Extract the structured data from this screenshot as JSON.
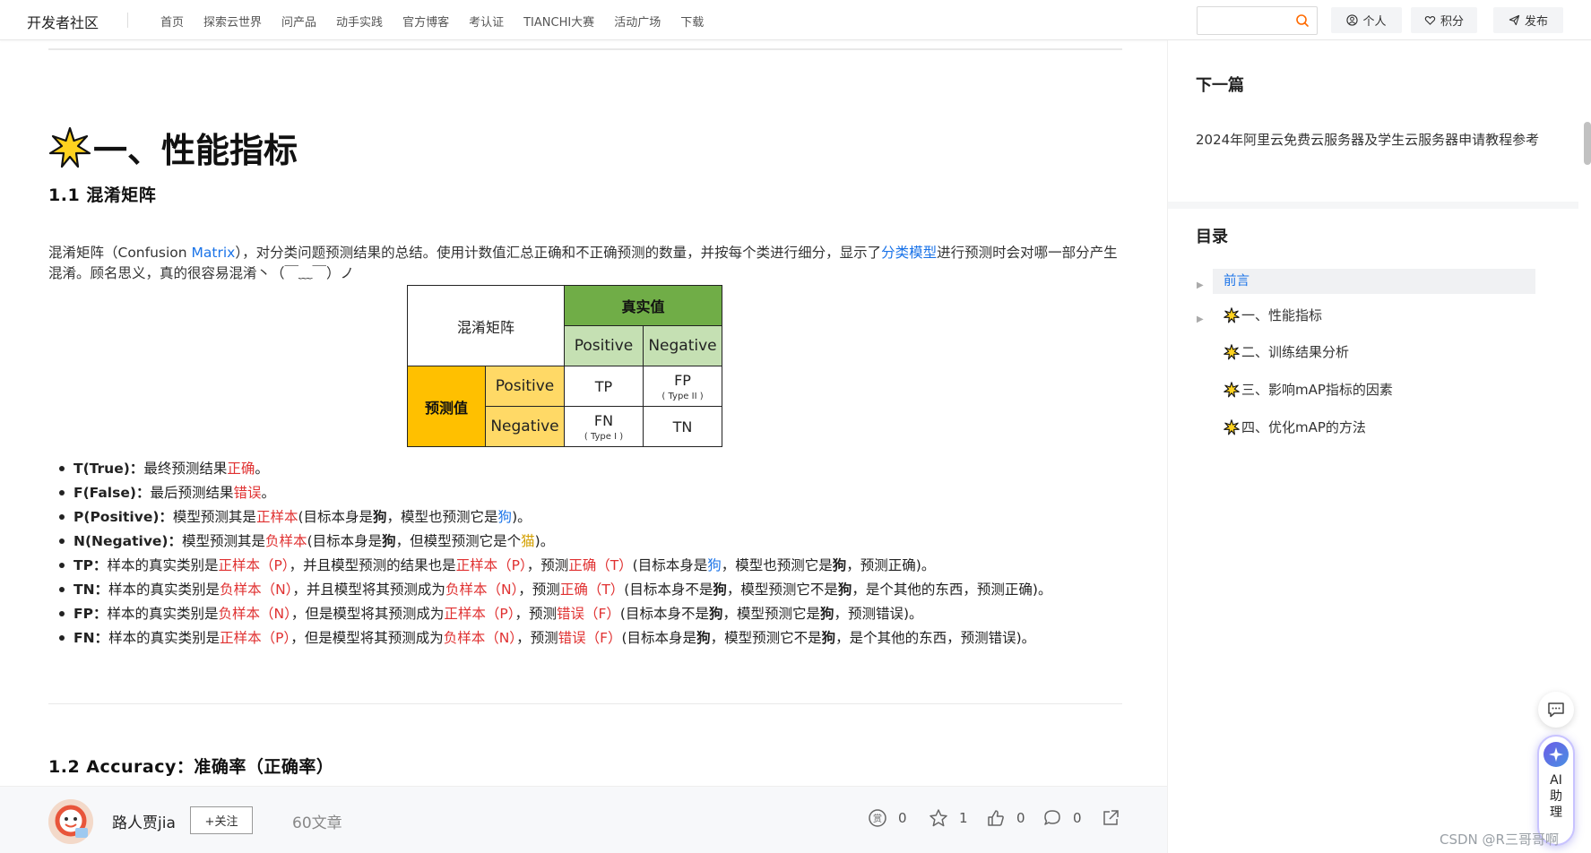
{
  "nav": {
    "brand": "开发者社区",
    "links": [
      "首页",
      "探索云世界",
      "问产品",
      "动手实践",
      "官方博客",
      "考认证",
      "TIANCHI大赛",
      "活动广场",
      "下载"
    ],
    "search_placeholder": "",
    "personal": "个人",
    "points": "积分",
    "publish": "发布"
  },
  "article": {
    "heading": "一、性能指标",
    "section_1_1": "1.1 混淆矩阵",
    "para": {
      "p1": "混淆矩阵（Confusion ",
      "p1_link": "Matrix",
      "p2": "），对分类问题预测结果的总结。使用计数值汇总正确和不正确预测的数量，并按每个类进行细分，显示了",
      "p2_link": "分类模型",
      "p3": "进行预测时会对哪一部分产生混淆。顾名思义，真的很容易混淆丶（￣﹏￣）ノ"
    },
    "matrix": {
      "corner": "混淆矩阵",
      "true_value": "真实值",
      "predicted": "预测值",
      "positive": "Positive",
      "negative": "Negative",
      "tp": "TP",
      "fp": "FP",
      "fp_sub": "( Type II )",
      "fn": "FN",
      "fn_sub": "( Type I )",
      "tn": "TN"
    },
    "bullets": {
      "t_key": "T(True)：",
      "t_text": "最终预测结果",
      "t_red": "正确",
      "t_end": "。",
      "f_key": "F(False)：",
      "f_text": "最后预测结果",
      "f_red": "错误",
      "f_end": "。",
      "p_key": "P(Positive)：",
      "p_text": "模型预测其是",
      "p_red": "正样本",
      "p_text2": "(目标本身是",
      "p_bold": "狗",
      "p_text3": "，模型也预测它是",
      "p_blue": "狗",
      "p_end": ")。",
      "n_key": "N(Negative)：",
      "n_text": "模型预测其是",
      "n_red": "负样本",
      "n_text2": "(目标本身是",
      "n_bold": "狗",
      "n_text3": "，但模型预测它是个",
      "n_gold": "猫",
      "n_end": ")。",
      "tp_key": "TP：",
      "tp_text": "样本的真实类别是",
      "tp_red1": "正样本（P）",
      "tp_text2": "，并且模型预测的结果也是",
      "tp_red2": "正样本（P）",
      "tp_text3": "，预测",
      "tp_red3": "正确（T）",
      "tp_text4": "(目标本身是",
      "tp_blue": "狗",
      "tp_text5": "，模型也预测它是",
      "tp_bold": "狗",
      "tp_end": "，预测正确)。",
      "tn_key": "TN：",
      "tn_text": "样本的真实类别是",
      "tn_red1": "负样本（N）",
      "tn_text2": "，并且模型将其预测成为",
      "tn_red2": "负样本（N）",
      "tn_text3": "，预测",
      "tn_red3": "正确（T）",
      "tn_text4": "(目标本身不是",
      "tn_bold1": "狗",
      "tn_text5": "，模型预测它不是",
      "tn_bold2": "狗",
      "tn_end": "，是个其他的东西，预测正确)。",
      "fp_key": "FP：",
      "fp_text": "样本的真实类别是",
      "fp_red1": "负样本（N）",
      "fp_text2": "，但是模型将其预测成为",
      "fp_red2": "正样本（P）",
      "fp_text3": "，预测",
      "fp_red3": "错误（F）",
      "fp_text4": "(目标本身不是",
      "fp_bold1": "狗",
      "fp_text5": "，模型预测它是",
      "fp_bold2": "狗",
      "fp_end": "，预测错误)。",
      "fn_key": "FN：",
      "fn_text": "样本的真实类别是",
      "fn_red1": "正样本（P）",
      "fn_text2": "，但是模型将其预测成为",
      "fn_red2": "负样本（N）",
      "fn_text3": "，预测",
      "fn_red3": "错误（F）",
      "fn_text4": "(目标本身是",
      "fn_bold1": "狗",
      "fn_text5": "，模型预测它不是",
      "fn_bold2": "狗",
      "fn_end": "，是个其他的东西，预测错误)。"
    },
    "section_1_2": "1.2  Accuracy：准确率（正确率）"
  },
  "author": {
    "name": "路人贾jia",
    "follow": "+关注",
    "article_count": "60文章",
    "stats": {
      "reward": "0",
      "favorite": "1",
      "like": "0",
      "comment": "0"
    }
  },
  "sidebar": {
    "next_title": "下一篇",
    "next_link": "2024年阿里云免费云服务器及学生云服务器申请教程参考",
    "toc_title": "目录",
    "toc": [
      "前言",
      "一、性能指标",
      "二、训练结果分析",
      "三、影响mAP指标的因素",
      "四、优化mAP的方法"
    ]
  },
  "floating": {
    "ai_text": "AI助理"
  },
  "watermark": "CSDN @R三哥哥啊",
  "colors": {
    "link_blue": "#1a73e8",
    "red": "#e03131",
    "green_header": "#70ad47",
    "orange": "#ffc000"
  }
}
